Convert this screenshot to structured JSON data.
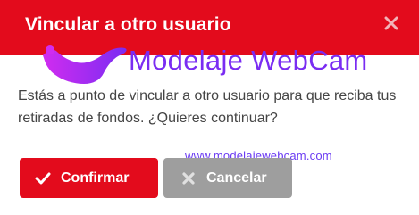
{
  "dialog": {
    "title": "Vincular a otro usuario",
    "message": "Estás a punto de vincular a otro usuario para que reciba tus retiradas de fondos. ¿Quieres continuar?",
    "confirm_label": "Confirmar",
    "cancel_label": "Cancelar"
  },
  "watermark": {
    "brand": "Modelaje WebCam",
    "url": "www.modelajewebcam.com"
  },
  "colors": {
    "header": "#e30b1c",
    "confirm_button": "#e30b1c",
    "cancel_button": "#9e9e9e",
    "watermark": "#7a2cf2"
  },
  "icons": {
    "close": "close-icon",
    "confirm": "checkmark-icon",
    "cancel": "x-icon",
    "logo": "silhouette-logo"
  }
}
